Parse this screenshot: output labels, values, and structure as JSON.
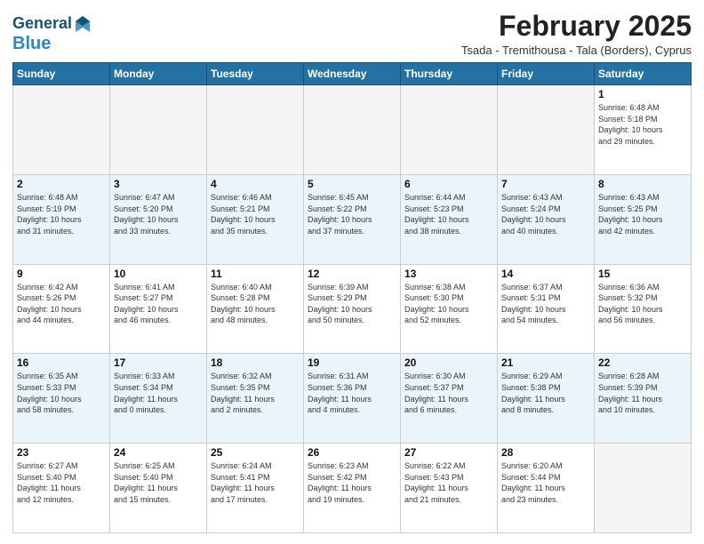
{
  "header": {
    "logo_line1": "General",
    "logo_line2": "Blue",
    "title": "February 2025",
    "subtitle": "Tsada - Tremithousa - Tala (Borders), Cyprus"
  },
  "days_of_week": [
    "Sunday",
    "Monday",
    "Tuesday",
    "Wednesday",
    "Thursday",
    "Friday",
    "Saturday"
  ],
  "weeks": [
    [
      {
        "day": "",
        "info": ""
      },
      {
        "day": "",
        "info": ""
      },
      {
        "day": "",
        "info": ""
      },
      {
        "day": "",
        "info": ""
      },
      {
        "day": "",
        "info": ""
      },
      {
        "day": "",
        "info": ""
      },
      {
        "day": "1",
        "info": "Sunrise: 6:48 AM\nSunset: 5:18 PM\nDaylight: 10 hours\nand 29 minutes."
      }
    ],
    [
      {
        "day": "2",
        "info": "Sunrise: 6:48 AM\nSunset: 5:19 PM\nDaylight: 10 hours\nand 31 minutes."
      },
      {
        "day": "3",
        "info": "Sunrise: 6:47 AM\nSunset: 5:20 PM\nDaylight: 10 hours\nand 33 minutes."
      },
      {
        "day": "4",
        "info": "Sunrise: 6:46 AM\nSunset: 5:21 PM\nDaylight: 10 hours\nand 35 minutes."
      },
      {
        "day": "5",
        "info": "Sunrise: 6:45 AM\nSunset: 5:22 PM\nDaylight: 10 hours\nand 37 minutes."
      },
      {
        "day": "6",
        "info": "Sunrise: 6:44 AM\nSunset: 5:23 PM\nDaylight: 10 hours\nand 38 minutes."
      },
      {
        "day": "7",
        "info": "Sunrise: 6:43 AM\nSunset: 5:24 PM\nDaylight: 10 hours\nand 40 minutes."
      },
      {
        "day": "8",
        "info": "Sunrise: 6:43 AM\nSunset: 5:25 PM\nDaylight: 10 hours\nand 42 minutes."
      }
    ],
    [
      {
        "day": "9",
        "info": "Sunrise: 6:42 AM\nSunset: 5:26 PM\nDaylight: 10 hours\nand 44 minutes."
      },
      {
        "day": "10",
        "info": "Sunrise: 6:41 AM\nSunset: 5:27 PM\nDaylight: 10 hours\nand 46 minutes."
      },
      {
        "day": "11",
        "info": "Sunrise: 6:40 AM\nSunset: 5:28 PM\nDaylight: 10 hours\nand 48 minutes."
      },
      {
        "day": "12",
        "info": "Sunrise: 6:39 AM\nSunset: 5:29 PM\nDaylight: 10 hours\nand 50 minutes."
      },
      {
        "day": "13",
        "info": "Sunrise: 6:38 AM\nSunset: 5:30 PM\nDaylight: 10 hours\nand 52 minutes."
      },
      {
        "day": "14",
        "info": "Sunrise: 6:37 AM\nSunset: 5:31 PM\nDaylight: 10 hours\nand 54 minutes."
      },
      {
        "day": "15",
        "info": "Sunrise: 6:36 AM\nSunset: 5:32 PM\nDaylight: 10 hours\nand 56 minutes."
      }
    ],
    [
      {
        "day": "16",
        "info": "Sunrise: 6:35 AM\nSunset: 5:33 PM\nDaylight: 10 hours\nand 58 minutes."
      },
      {
        "day": "17",
        "info": "Sunrise: 6:33 AM\nSunset: 5:34 PM\nDaylight: 11 hours\nand 0 minutes."
      },
      {
        "day": "18",
        "info": "Sunrise: 6:32 AM\nSunset: 5:35 PM\nDaylight: 11 hours\nand 2 minutes."
      },
      {
        "day": "19",
        "info": "Sunrise: 6:31 AM\nSunset: 5:36 PM\nDaylight: 11 hours\nand 4 minutes."
      },
      {
        "day": "20",
        "info": "Sunrise: 6:30 AM\nSunset: 5:37 PM\nDaylight: 11 hours\nand 6 minutes."
      },
      {
        "day": "21",
        "info": "Sunrise: 6:29 AM\nSunset: 5:38 PM\nDaylight: 11 hours\nand 8 minutes."
      },
      {
        "day": "22",
        "info": "Sunrise: 6:28 AM\nSunset: 5:39 PM\nDaylight: 11 hours\nand 10 minutes."
      }
    ],
    [
      {
        "day": "23",
        "info": "Sunrise: 6:27 AM\nSunset: 5:40 PM\nDaylight: 11 hours\nand 12 minutes."
      },
      {
        "day": "24",
        "info": "Sunrise: 6:25 AM\nSunset: 5:40 PM\nDaylight: 11 hours\nand 15 minutes."
      },
      {
        "day": "25",
        "info": "Sunrise: 6:24 AM\nSunset: 5:41 PM\nDaylight: 11 hours\nand 17 minutes."
      },
      {
        "day": "26",
        "info": "Sunrise: 6:23 AM\nSunset: 5:42 PM\nDaylight: 11 hours\nand 19 minutes."
      },
      {
        "day": "27",
        "info": "Sunrise: 6:22 AM\nSunset: 5:43 PM\nDaylight: 11 hours\nand 21 minutes."
      },
      {
        "day": "28",
        "info": "Sunrise: 6:20 AM\nSunset: 5:44 PM\nDaylight: 11 hours\nand 23 minutes."
      },
      {
        "day": "",
        "info": ""
      }
    ]
  ]
}
